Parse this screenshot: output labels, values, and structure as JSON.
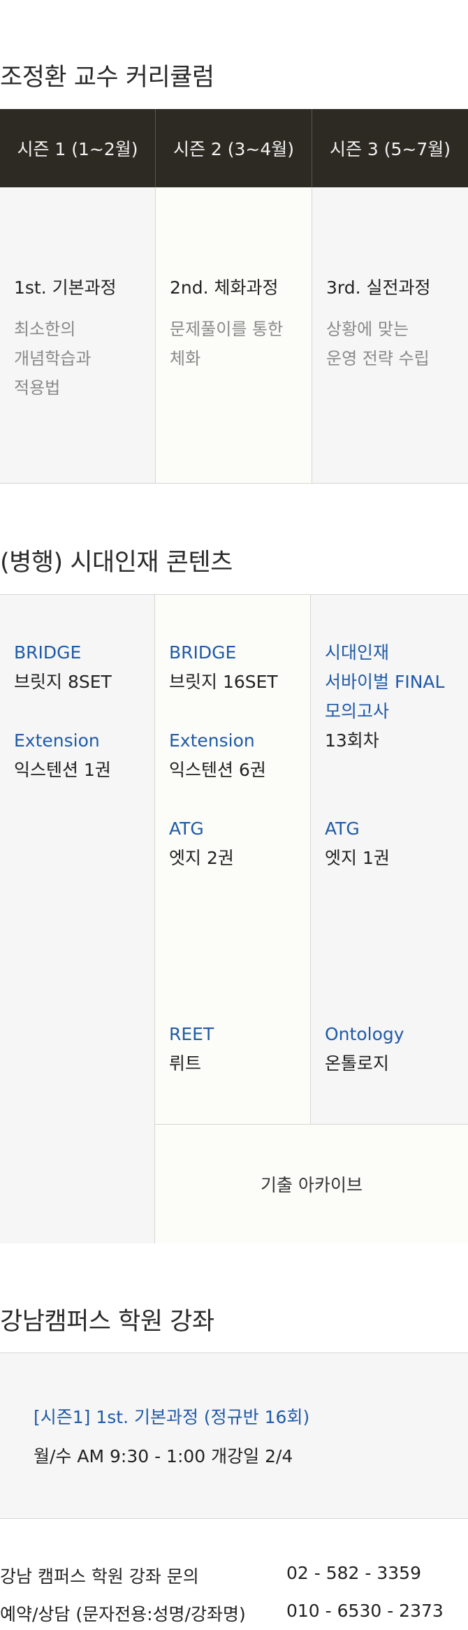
{
  "curriculum": {
    "title": "조정환 교수 커리큘럼",
    "seasons": [
      {
        "header": "시즌 1 (1~2월)",
        "course": "1st. 기본과정",
        "description": "최소한의\n개념학습과\n적용법"
      },
      {
        "header": "시즌 2 (3~4월)",
        "course": "2nd. 체화과정",
        "description": "문제풀이를 통한\n체화"
      },
      {
        "header": "시즌 3 (5~7월)",
        "course": "3rd. 실전과정",
        "description": "상황에 맞는\n운영 전략 수립"
      }
    ]
  },
  "contents": {
    "title": "(병행) 시대인재 콘텐츠",
    "col1": {
      "bridge_en": "BRIDGE",
      "bridge_ko": "브릿지 8SET",
      "ext_en": "Extension",
      "ext_ko": "익스텐션 1권"
    },
    "col2": {
      "bridge_en": "BRIDGE",
      "bridge_ko": "브릿지 16SET",
      "ext_en": "Extension",
      "ext_ko": "익스텐션 6권",
      "atg_en": "ATG",
      "atg_ko": "엣지 2권",
      "reet_en": "REET",
      "reet_ko": "뤼트"
    },
    "col3": {
      "final_en": "시대인재\n서바이벌 FINAL\n모의고사",
      "final_ko": "13회차",
      "atg_en": "ATG",
      "atg_ko": "엣지 1권",
      "onto_en": "Ontology",
      "onto_ko": "온톨로지"
    },
    "archive": "기출 아카이브"
  },
  "campus": {
    "title": "강남캠퍼스 학원 강좌",
    "lecture_title": "[시즌1] 1st. 기본과정 (정규반 16회)",
    "lecture_time": "월/수 AM 9:30 - 1:00  개강일 2/4"
  },
  "contact": {
    "inquiry_label": "강남 캠퍼스 학원 강좌 문의",
    "inquiry_phone": "02 - 582 - 3359",
    "booking_label": "예약/상담 (문자전용:성명/강좌명)",
    "booking_phone": "010 - 6530 - 2373"
  },
  "colors": {
    "header_bg": "#2c2a23",
    "accent_blue": "#1f5aa8",
    "gray_cell": "#f6f6f6",
    "cream_cell": "#fcfcf8"
  }
}
